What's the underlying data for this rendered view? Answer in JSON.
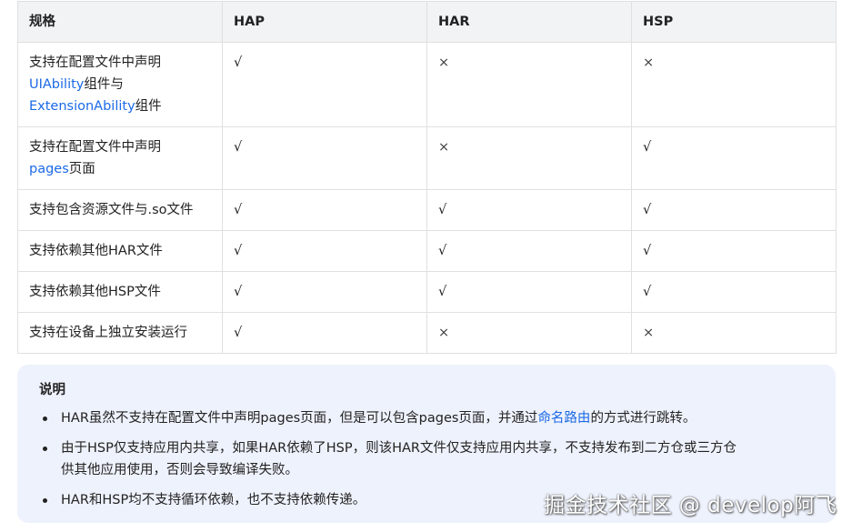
{
  "table": {
    "headers": [
      "规格",
      "HAP",
      "HAR",
      "HSP"
    ],
    "rows": [
      {
        "label_parts": [
          "支持在配置文件中声明",
          "UIAbility",
          "组件与",
          "ExtensionAbility",
          "组件"
        ],
        "hap": "√",
        "har": "×",
        "hsp": "×"
      },
      {
        "label_parts": [
          "支持在配置文件中声明",
          "pages",
          "页面"
        ],
        "hap": "√",
        "har": "×",
        "hsp": "√"
      },
      {
        "label": "支持包含资源文件与.so文件",
        "hap": "√",
        "har": "√",
        "hsp": "√"
      },
      {
        "label": "支持依赖其他HAR文件",
        "hap": "√",
        "har": "√",
        "hsp": "√"
      },
      {
        "label": "支持依赖其他HSP文件",
        "hap": "√",
        "har": "√",
        "hsp": "√"
      },
      {
        "label": "支持在设备上独立安装运行",
        "hap": "√",
        "har": "×",
        "hsp": "×"
      }
    ]
  },
  "note": {
    "title": "说明",
    "items": [
      {
        "before": "HAR虽然不支持在配置文件中声明pages页面，但是可以包含pages页面，并通过",
        "link": "命名路由",
        "after": "的方式进行跳转。"
      },
      {
        "line1": "由于HSP仅支持应用内共享，如果HAR依赖了HSP，则该HAR文件仅支持应用内共享，不支持发布到二方仓或三方仓",
        "line2": "供其他应用使用，否则会导致编译失败。"
      },
      {
        "text": "HAR和HSP均不支持循环依赖，也不支持依赖传递。"
      }
    ]
  },
  "watermark": "掘金技术社区 @ develop阿飞"
}
